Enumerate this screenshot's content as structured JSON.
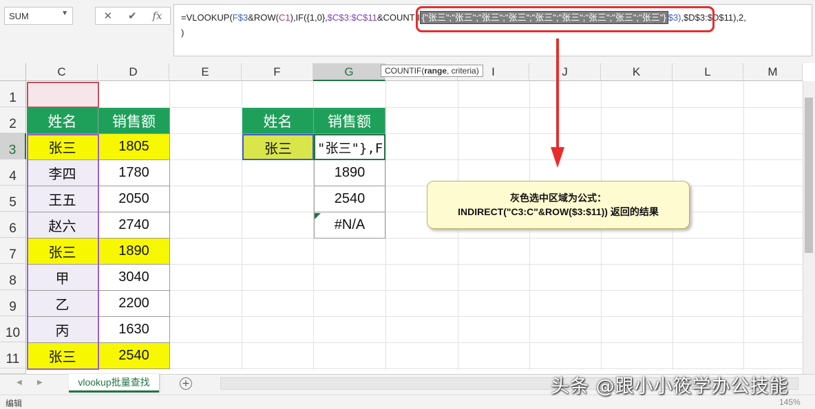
{
  "namebox": {
    "value": "SUM"
  },
  "fx_buttons": {
    "cancel": "✕",
    "enter": "✔",
    "fx": "fx"
  },
  "formula": {
    "p1": "=VLOOKUP(",
    "r1": "F$3",
    "p2": "&ROW(",
    "r2": "C1",
    "p3": "),IF({1,0},",
    "r3": "$C$3:$C$11",
    "p4": "&COUNTII",
    "selected": "{\"张三\";\"张三\";\"张三\";\"张三\";\"张三\";\"张三\";\"张三\";\"张三\";\"张三\"}",
    "p5": "$3)",
    "p6": ",$D$3:$D$11),2,",
    "line2": ")"
  },
  "tooltip": {
    "fn": "COUNTIF(",
    "arg1": "range",
    "rest": ", criteria)"
  },
  "columns": [
    "C",
    "D",
    "E",
    "F",
    "G",
    "H",
    "I",
    "J",
    "K",
    "L",
    "M"
  ],
  "rows": [
    "1",
    "2",
    "3",
    "4",
    "5",
    "6",
    "7",
    "8",
    "9",
    "10",
    "11"
  ],
  "table1": {
    "header": [
      "姓名",
      "销售额"
    ],
    "names": [
      "张三",
      "李四",
      "王五",
      "赵六",
      "张三",
      "甲",
      "乙",
      "丙",
      "张三"
    ],
    "amounts": [
      "1805",
      "1780",
      "2050",
      "2740",
      "1890",
      "3040",
      "2200",
      "1630",
      "2540"
    ]
  },
  "table2": {
    "header": [
      "姓名",
      "销售额"
    ],
    "name": "张三",
    "editing": "\"张三\"},F$",
    "results": [
      "1890",
      "2540",
      "#N/A"
    ]
  },
  "callout": {
    "line1": "灰色选中区域为公式：",
    "line2": "INDIRECT(\"C3:C\"&ROW($3:$11)) 返回的结果"
  },
  "sheet_tab": "vlookup批量查找",
  "status": "编辑",
  "zoom": "145%",
  "watermark": "头条 @跟小小筱学办公技能",
  "colors": {
    "green": "#1fa05a",
    "yellow": "#f7f700",
    "red": "#e82c2c"
  }
}
